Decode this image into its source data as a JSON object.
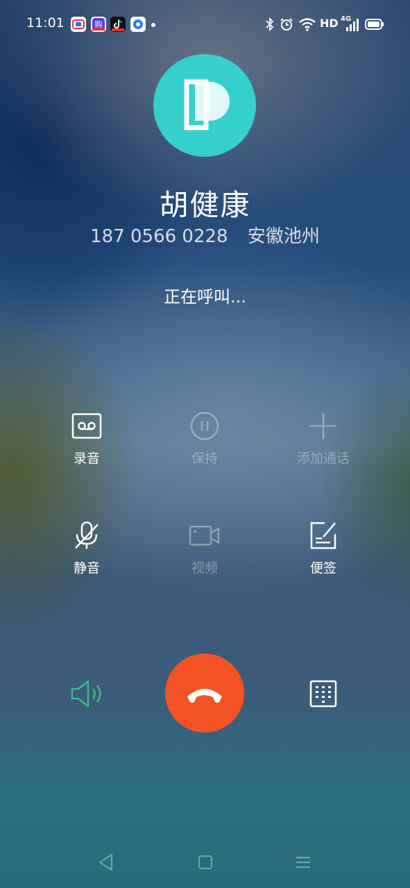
{
  "status_bar": {
    "time": "11:01",
    "network_label": "HD",
    "cellular_label": "4G"
  },
  "contact": {
    "name": "胡健康",
    "number": "187 0566 0228",
    "location": "安徽池州",
    "avatar_icon": "contact-avatar-p-icon"
  },
  "call_status": "正在呼叫...",
  "controls": {
    "record": {
      "label": "录音",
      "enabled": true
    },
    "hold": {
      "label": "保持",
      "enabled": false
    },
    "add_call": {
      "label": "添加通话",
      "enabled": false
    },
    "mute": {
      "label": "静音",
      "enabled": true
    },
    "video": {
      "label": "视频",
      "enabled": false
    },
    "notes": {
      "label": "便签",
      "enabled": true
    }
  },
  "colors": {
    "end_call": "#f35224",
    "speaker": "#3dbd8a",
    "avatar": "#36d0cc"
  }
}
